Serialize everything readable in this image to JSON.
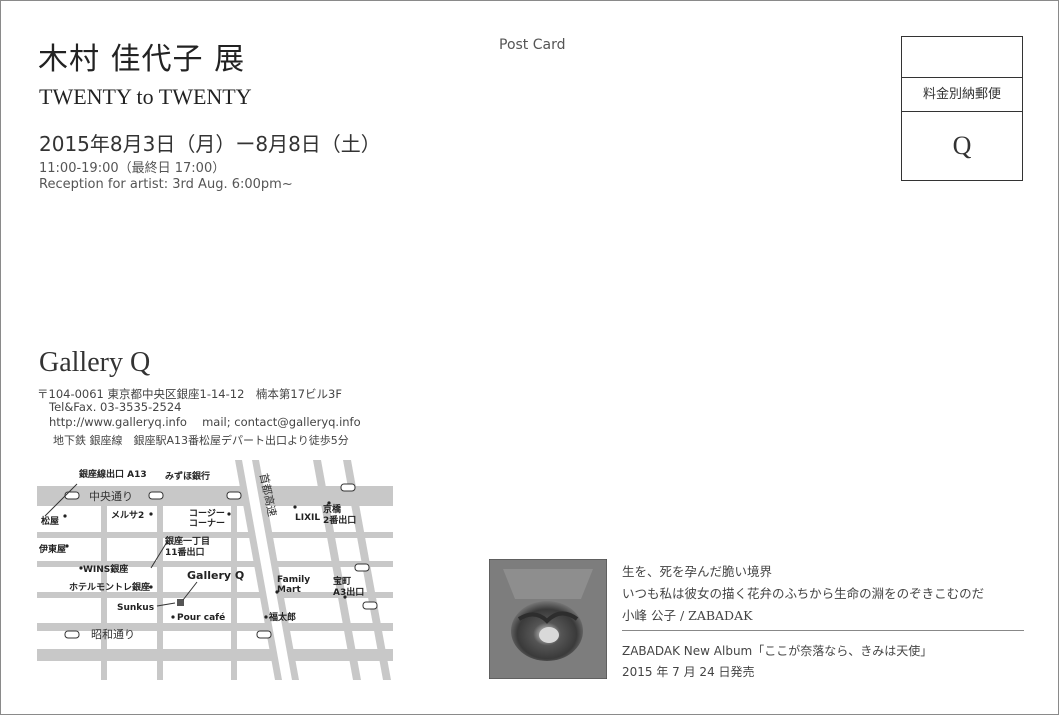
{
  "exhibition": {
    "title_jp": "木村 佳代子 展",
    "title_en": "TWENTY to TWENTY",
    "dates": "2015年8月3日（月）ー8月8日（土）",
    "hours": "11:00-19:00（最終日 17:00）",
    "reception": "Reception for artist: 3rd Aug. 6:00pm~"
  },
  "postcard_label": "Post Card",
  "stamp": {
    "label": "料金別納郵便",
    "mark": "Q"
  },
  "gallery": {
    "name": "Gallery Q",
    "address": "〒104-0061 東京都中央区銀座1-14-12　楠本第17ビル3F",
    "tel": "Tel&Fax. 03-3535-2524",
    "web": "http://www.galleryq.info　 mail; contact@galleryq.info",
    "access": "地下鉄 銀座線　銀座駅A13番松屋デパート出口より徒歩5分"
  },
  "map": {
    "exit_a13": "銀座線出口 A13",
    "mizuho": "みずほ銀行",
    "chuo_dori": "中央通り",
    "matsuya": "松屋",
    "melsa": "メルサ2",
    "kohi_1": "コージー",
    "kohi_2": "コーナー",
    "lixil": "LIXIL",
    "kyobashi_1": "京橋",
    "kyobashi_2": "2番出口",
    "isetan": "伊東屋",
    "ginza1_1": "銀座一丁目",
    "ginza1_2": "11番出口",
    "shuto": "首都高速",
    "wins": "WINS銀座",
    "gallery_label": "Gallery Q",
    "hotel": "ホテルモントレ銀座",
    "family_1": "Family",
    "family_2": "Mart",
    "takara_1": "宝町",
    "takara_2": "A3出口",
    "sunkus": "Sunkus",
    "pourcafe": "Pour café",
    "fukutaro": "福太郎",
    "showa_dori": "昭和通り"
  },
  "album": {
    "poem_line1": "生を、死を孕んだ脆い境界",
    "poem_line2": "いつも私は彼女の描く花弁のふちから生命の淵をのぞきこむのだ",
    "poem_credit": "小峰 公子 / ZABADAK",
    "album_title": "ZABADAK New Album「ここが奈落なら、きみは天使」",
    "release": "2015 年 7 月 24 日発売"
  },
  "colors": {
    "road": "#c8c8c8",
    "text": "#333333",
    "border": "#8a8a8a"
  }
}
